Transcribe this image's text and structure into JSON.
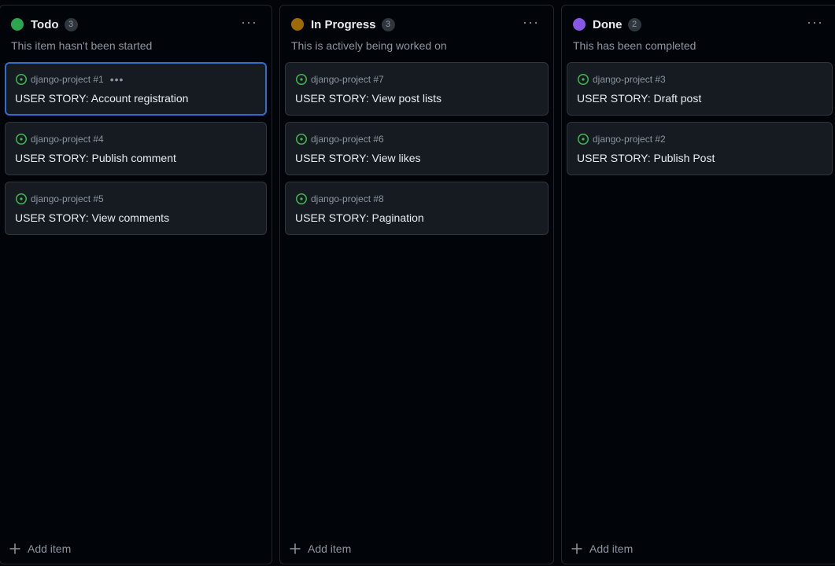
{
  "columns": [
    {
      "title": "Todo",
      "count": "3",
      "color": "#2da44e",
      "description": "This item hasn't been started",
      "add_label": "Add item",
      "cards": [
        {
          "repo": "django-project #1",
          "title": "USER STORY: Account registration",
          "selected": true
        },
        {
          "repo": "django-project #4",
          "title": "USER STORY: Publish comment"
        },
        {
          "repo": "django-project #5",
          "title": "USER STORY: View comments"
        }
      ]
    },
    {
      "title": "In Progress",
      "count": "3",
      "color": "#9e6a03",
      "description": "This is actively being worked on",
      "add_label": "Add item",
      "cards": [
        {
          "repo": "django-project #7",
          "title": "USER STORY: View post lists"
        },
        {
          "repo": "django-project #6",
          "title": "USER STORY: View likes"
        },
        {
          "repo": "django-project #8",
          "title": "USER STORY: Pagination"
        }
      ]
    },
    {
      "title": "Done",
      "count": "2",
      "color": "#8957e5",
      "description": "This has been completed",
      "add_label": "Add item",
      "cards": [
        {
          "repo": "django-project #3",
          "title": "USER STORY: Draft post"
        },
        {
          "repo": "django-project #2",
          "title": "USER STORY: Publish Post"
        }
      ]
    }
  ],
  "icons": {
    "issue": "issue-open-icon",
    "menu": "kebab-horizontal-icon",
    "add": "plus-icon"
  },
  "colors": {
    "issue_open": "#3fb950",
    "accent_selected": "#316dca"
  }
}
